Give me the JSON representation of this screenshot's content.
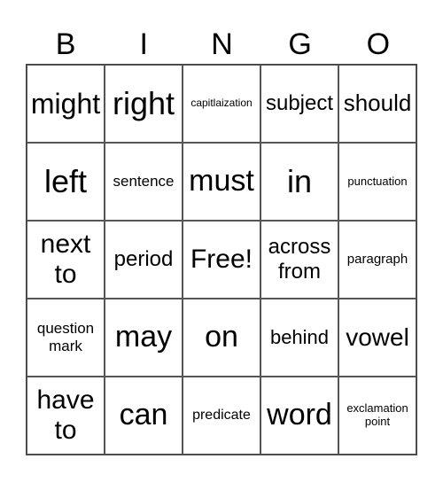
{
  "header": [
    "B",
    "I",
    "N",
    "G",
    "O"
  ],
  "cells": [
    {
      "text": "might",
      "size": 32
    },
    {
      "text": "right",
      "size": 36
    },
    {
      "text": "capitlaization",
      "size": 12
    },
    {
      "text": "subject",
      "size": 24
    },
    {
      "text": "should",
      "size": 26
    },
    {
      "text": "left",
      "size": 36
    },
    {
      "text": "sentence",
      "size": 17
    },
    {
      "text": "must",
      "size": 34
    },
    {
      "text": "in",
      "size": 36
    },
    {
      "text": "punctuation",
      "size": 13
    },
    {
      "text": "next to",
      "size": 30
    },
    {
      "text": "period",
      "size": 24
    },
    {
      "text": "Free!",
      "size": 30
    },
    {
      "text": "across from",
      "size": 24
    },
    {
      "text": "paragraph",
      "size": 15
    },
    {
      "text": "question mark",
      "size": 17
    },
    {
      "text": "may",
      "size": 34
    },
    {
      "text": "on",
      "size": 34
    },
    {
      "text": "behind",
      "size": 22
    },
    {
      "text": "vowel",
      "size": 28
    },
    {
      "text": "have to",
      "size": 30
    },
    {
      "text": "can",
      "size": 34
    },
    {
      "text": "predicate",
      "size": 16
    },
    {
      "text": "word",
      "size": 34
    },
    {
      "text": "exclamation point",
      "size": 13
    }
  ]
}
